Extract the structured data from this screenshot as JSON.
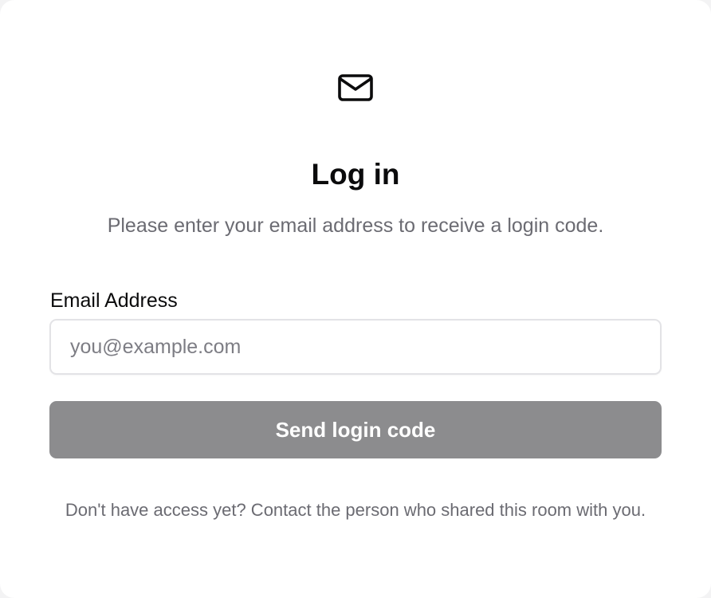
{
  "icon": {
    "name": "mail-icon"
  },
  "header": {
    "title": "Log in",
    "subtitle": "Please enter your email address to receive a login code."
  },
  "form": {
    "email_label": "Email Address",
    "email_value": "",
    "email_placeholder": "you@example.com",
    "submit_label": "Send login code"
  },
  "footer": {
    "text": "Don't have access yet? Contact the person who shared this room with you."
  },
  "colors": {
    "button_bg": "#8c8c8e",
    "subtitle_text": "#6b6b72"
  }
}
